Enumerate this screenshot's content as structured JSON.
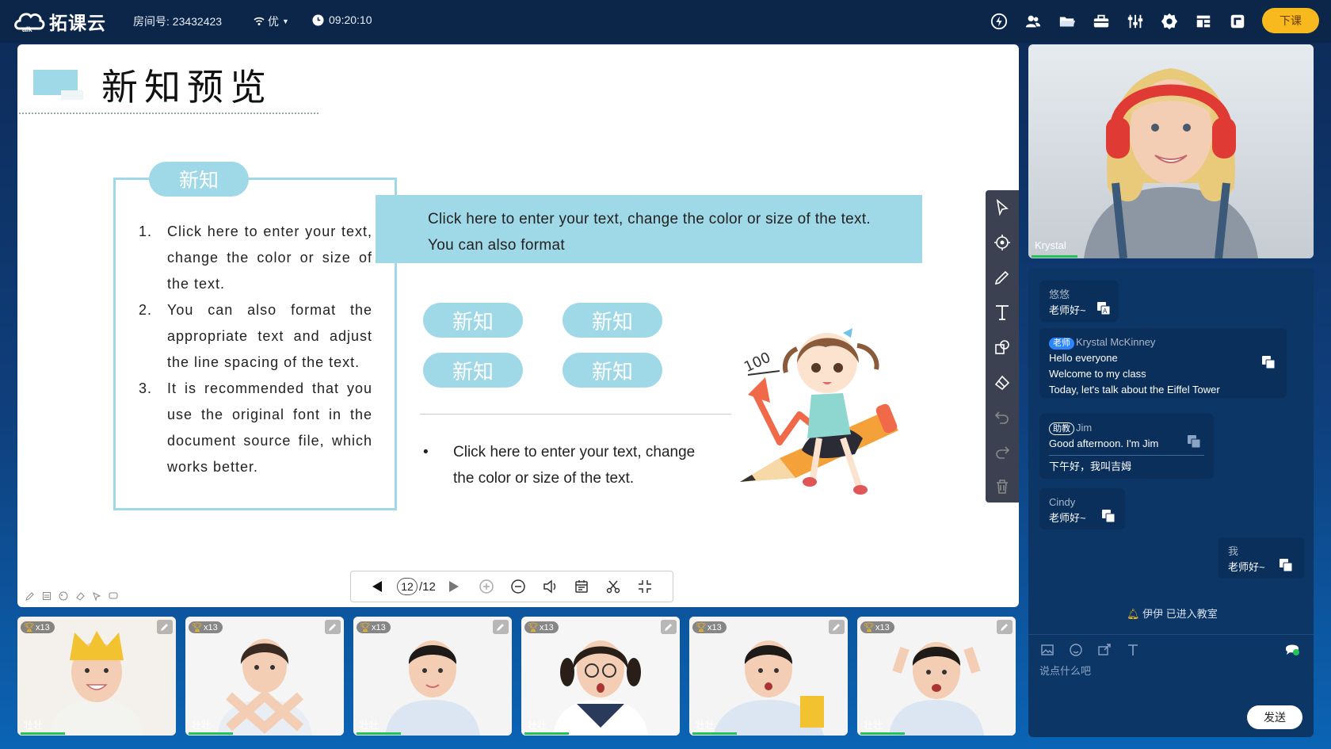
{
  "topbar": {
    "logo_text": "拓课云",
    "room_label": "房间号: 23432423",
    "network_quality": "优",
    "clock": "09:20:10",
    "end_class_label": "下课",
    "icons": [
      "lightning-icon",
      "users-icon",
      "folder-icon",
      "toolbox-icon",
      "sliders-icon",
      "settings-icon",
      "layout-icon",
      "fullscreen-icon"
    ]
  },
  "board": {
    "title": "新知预览",
    "top_pill": "新知",
    "list": [
      {
        "n": "1.",
        "text": "Click here to enter your text, change the color or size of the text."
      },
      {
        "n": "2.",
        "text": "You can also format the appropriate text and adjust the line spacing of the text."
      },
      {
        "n": "3.",
        "text": "It is recommended that you use the original font in the document source file, which works better."
      }
    ],
    "banner_text": "Click here to enter your text, change the color or size of the text. You can also format",
    "pills": [
      "新知",
      "新知",
      "新知",
      "新知"
    ],
    "bullet_text": "Click here to enter your text, change the color or size of the text.",
    "bullet_mark": "•",
    "illustration_text": "100",
    "accent_color": "#9fd8e6"
  },
  "pager": {
    "current": "12",
    "total": "/12"
  },
  "teacher": {
    "name": "Krystal"
  },
  "chat": {
    "messages": [
      {
        "sender": "悠悠",
        "lines": [
          "老师好~"
        ]
      },
      {
        "badge": "老师",
        "sender": "Krystal McKinney",
        "lines": [
          "Hello everyone",
          "Welcome to my class",
          "Today, let's talk about the Eiffel Tower"
        ]
      },
      {
        "badge": "助教",
        "sender": "Jim",
        "lines": [
          "Good afternoon. I'm Jim"
        ],
        "translation": "下午好，我叫吉姆"
      },
      {
        "sender": "Cindy",
        "lines": [
          "老师好~"
        ]
      },
      {
        "sender": "我",
        "lines": [
          "老师好~"
        ]
      }
    ],
    "notice": "伊伊 已进入教室",
    "placeholder": "说点什么吧",
    "send_label": "发送"
  },
  "students": [
    {
      "name": "壮壮",
      "trophies": "x13"
    },
    {
      "name": "壮壮",
      "trophies": "x13"
    },
    {
      "name": "壮壮",
      "trophies": "x13"
    },
    {
      "name": "壮壮",
      "trophies": "x13"
    },
    {
      "name": "壮壮",
      "trophies": "x13"
    },
    {
      "name": "壮壮",
      "trophies": "x13"
    }
  ]
}
